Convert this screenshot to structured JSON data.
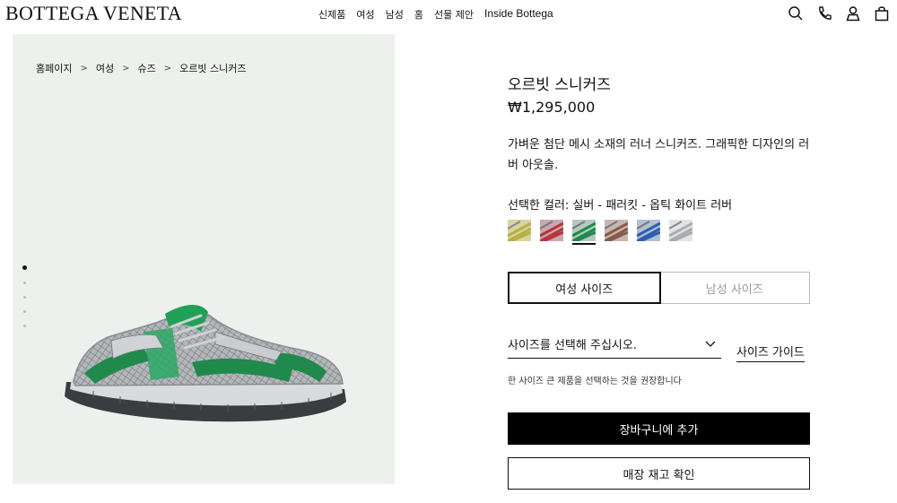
{
  "header": {
    "logo": "BOTTEGA VENETA",
    "nav": [
      "신제품",
      "여성",
      "남성",
      "홈",
      "선물 제안",
      "Inside Bottega"
    ],
    "icons": [
      "search-icon",
      "phone-icon",
      "account-icon",
      "bag-icon"
    ]
  },
  "breadcrumb": [
    "홈페이지",
    "여성",
    "슈즈",
    "오르빗 스니커즈"
  ],
  "breadcrumb_separator": ">",
  "gallery": {
    "image_count": 5,
    "active_index": 0
  },
  "product": {
    "name": "오르빗 스니커즈",
    "price": "₩1,295,000",
    "description": "가벼운 첨단 메시 소재의 러너 스니커즈. 그래픽한 디자인의 러버 아웃솔.",
    "color_label": "선택한 컬러: 실버 - 패러킷 - 옵틱 화이트 러버",
    "swatches": [
      {
        "name": "yellow-swatch",
        "color": "#c9c24a"
      },
      {
        "name": "red-swatch",
        "color": "#b8343c"
      },
      {
        "name": "green-swatch",
        "color": "#1f8a4c",
        "selected": true
      },
      {
        "name": "brown-swatch",
        "color": "#8a5a4a"
      },
      {
        "name": "blue-swatch",
        "color": "#2a5fb0"
      },
      {
        "name": "silver-swatch",
        "color": "#b9bcbf"
      }
    ]
  },
  "size": {
    "tabs": [
      "여성 사이즈",
      "남성 사이즈"
    ],
    "active_tab": 0,
    "select_placeholder": "사이즈를 선택해 주십시오.",
    "guide_label": "사이즈 가이드",
    "note": "한 사이즈 큰 제품을 선택하는 것을 권장합니다"
  },
  "actions": {
    "add_to_cart": "장바구니에 추가",
    "check_stock": "매장 재고 확인"
  },
  "colors": {
    "accent": "#111111",
    "panel_bg": "#eef0ee",
    "shoe_green": "#1f8a4c"
  }
}
